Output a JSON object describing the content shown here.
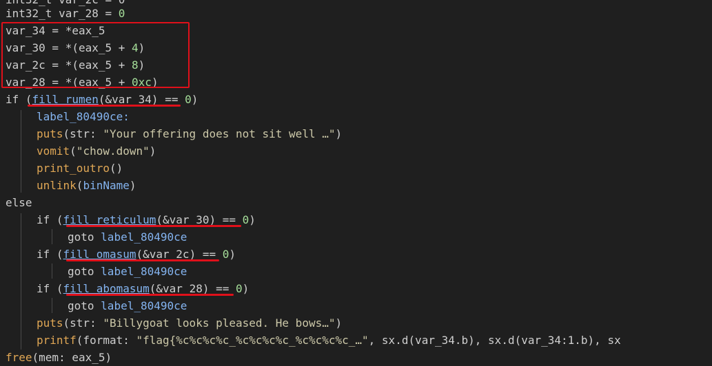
{
  "code": {
    "line0_partial": "int32_t var_2c = 0",
    "line1_type": "int32_t",
    "line1_var": "var_28",
    "line1_eq": " = ",
    "line1_num": "0",
    "line2": "var_34 = *eax_5",
    "line3_a": "var_30 = *(eax_5 + ",
    "line3_num": "4",
    "line3_b": ")",
    "line4_a": "var_2c = *(eax_5 + ",
    "line4_num": "8",
    "line4_b": ")",
    "line5_a": "var_28 = *(eax_5 + ",
    "line5_num": "0xc",
    "line5_b": ")",
    "line6_if": "if (",
    "line6_fn": "fill_rumen",
    "line6_arg": "(&var_34)",
    "line6_cmp": " == ",
    "line6_num": "0",
    "line6_end": ")",
    "line7_label": "label_80490ce:",
    "line8_fn": "puts",
    "line8_arg": "(str: ",
    "line8_str": "\"Your offering does not sit well …\"",
    "line8_end": ")",
    "line9_fn": "vomit",
    "line9_open": "(",
    "line9_str": "\"chow.down\"",
    "line9_end": ")",
    "line10_fn": "print_outro",
    "line10_end": "()",
    "line11_fn": "unlink",
    "line11_open": "(",
    "line11_arg": "binName",
    "line11_end": ")",
    "line12": "else",
    "line13_if": "if (",
    "line13_fn": "fill_reticulum",
    "line13_arg": "(&var_30)",
    "line13_cmp": " == ",
    "line13_num": "0",
    "line13_end": ")",
    "line14_goto": "goto ",
    "line14_label": "label_80490ce",
    "line15_if": "if (",
    "line15_fn": "fill_omasum",
    "line15_arg": "(&var_2c)",
    "line15_cmp": " == ",
    "line15_num": "0",
    "line15_end": ")",
    "line16_goto": "goto ",
    "line16_label": "label_80490ce",
    "line17_if": "if (",
    "line17_fn": "fill_abomasum",
    "line17_arg": "(&var_28)",
    "line17_cmp": " == ",
    "line17_num": "0",
    "line17_end": ")",
    "line18_goto": "goto ",
    "line18_label": "label_80490ce",
    "line19_fn": "puts",
    "line19_arg": "(str: ",
    "line19_str": "\"Billygoat looks pleased. He bows…\"",
    "line19_end": ")",
    "line20_fn": "printf",
    "line20_arg": "(format: ",
    "line20_str": "\"flag{%c%c%c%c_%c%c%c%c_%c%c%c%c_…\"",
    "line20_rest": ", sx.d(var_34.b), sx.d(var_34:1.b), sx",
    "line21_fn": "free",
    "line21_arg": "(mem: eax_5)"
  },
  "colors": {
    "background": "#1f1f1f",
    "function": "#e0a755",
    "label": "#84b4f0",
    "number": "#a6df9a",
    "highlight_red": "#e0101a"
  }
}
